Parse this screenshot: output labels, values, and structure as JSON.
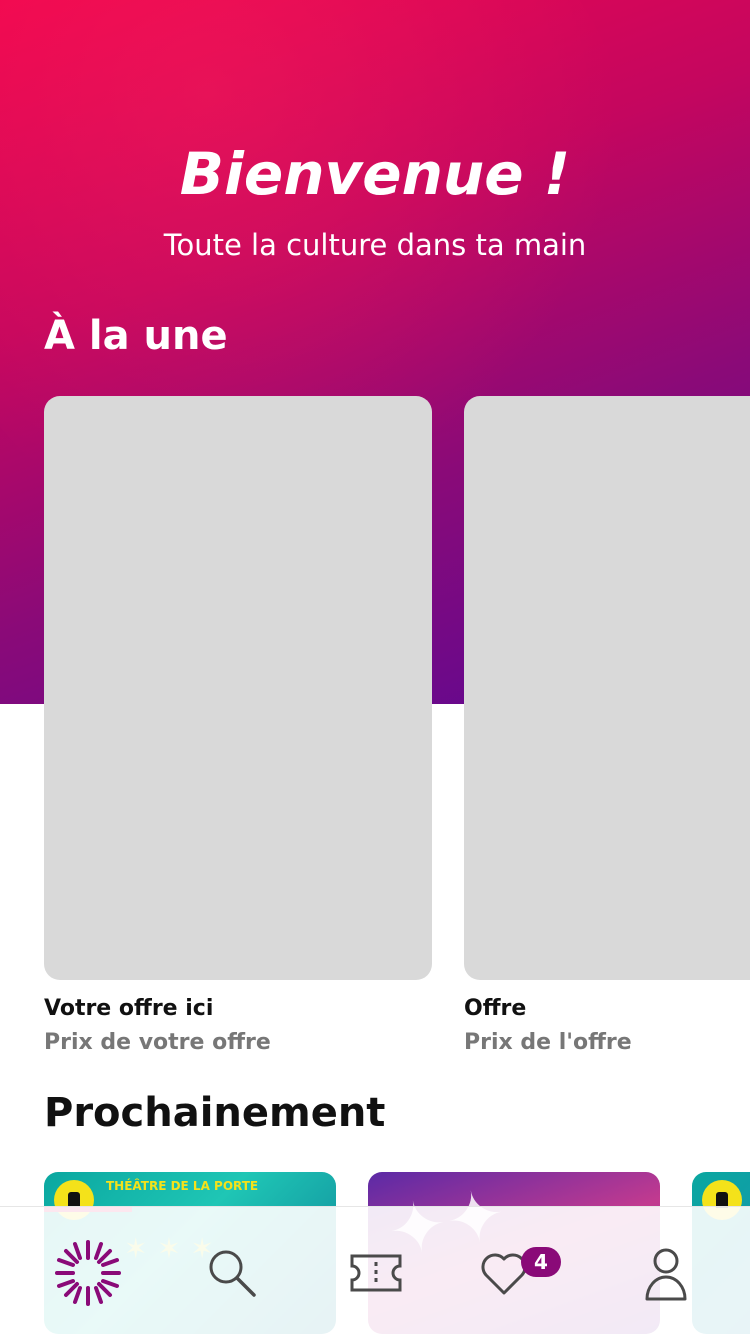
{
  "hero": {
    "title": "Bienvenue !",
    "subtitle": "Toute la culture dans ta main",
    "colors": {
      "start": "#f0054f",
      "mid": "#c4065f",
      "end": "#5b0894"
    }
  },
  "featured": {
    "heading": "À la une",
    "offers": [
      {
        "title": "Votre offre ici",
        "price": "Prix de votre offre"
      },
      {
        "title": "Offre",
        "price": "Prix de l'offre"
      }
    ]
  },
  "upcoming": {
    "heading": "Prochainement",
    "items": [
      {
        "venue": "THÉÂTRE DE LA PORTE",
        "image": "theatre-poster"
      },
      {
        "image": "soldiers-poster"
      },
      {
        "image": "theatre-poster-partial"
      }
    ]
  },
  "tabbar": {
    "tabs": [
      {
        "name": "home",
        "icon": "sun-logo-icon",
        "active": true
      },
      {
        "name": "search",
        "icon": "search-icon"
      },
      {
        "name": "bookings",
        "icon": "ticket-icon"
      },
      {
        "name": "favorites",
        "icon": "heart-icon",
        "badge": "4"
      },
      {
        "name": "profile",
        "icon": "user-icon"
      }
    ],
    "colors": {
      "accent": "#8a0a78",
      "inactive": "#4a4a4a"
    }
  }
}
